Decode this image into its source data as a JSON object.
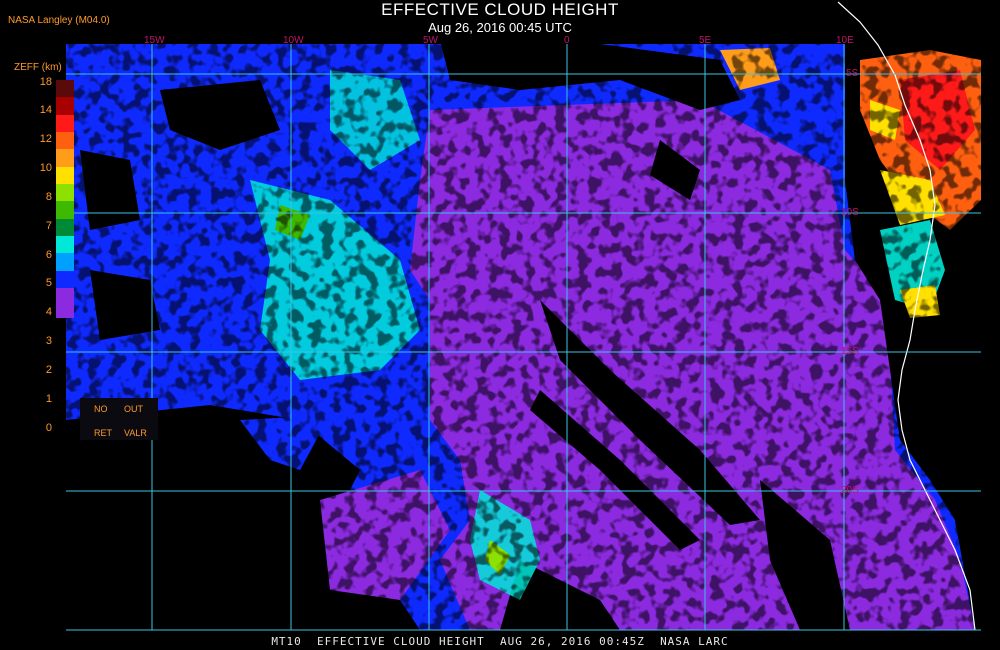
{
  "header": {
    "title": "EFFECTIVE CLOUD HEIGHT",
    "datetime": "Aug 26, 2016 00:45 UTC",
    "org_label": "NASA Langley (M04.0)"
  },
  "map": {
    "longitude_labels": [
      "15W",
      "10W",
      "5W",
      "0",
      "5E",
      "10E"
    ],
    "latitude_labels": [
      "5S",
      "10S",
      "15S",
      "20S"
    ]
  },
  "colorbar": {
    "label": "ZEFF (km)",
    "ticks": [
      "18",
      "14",
      "12",
      "10",
      "8",
      "7",
      "6",
      "5",
      "4",
      "3",
      "2",
      "1",
      "0"
    ],
    "colors": [
      "#5a0a0a",
      "#a80000",
      "#ff1a1a",
      "#ff6010",
      "#ff9c1a",
      "#ffe000",
      "#8ee000",
      "#3fb800",
      "#008a38",
      "#00e8d8",
      "#00a0ff",
      "#0f2aff",
      "#8c2ae0"
    ],
    "legend": {
      "no": "NO",
      "out": "OUT",
      "ret": "RET",
      "valr": "VALR"
    }
  },
  "footer": {
    "text": "MT10  EFFECTIVE CLOUD HEIGHT  AUG 26, 2016 00:45Z  NASA LARC"
  }
}
